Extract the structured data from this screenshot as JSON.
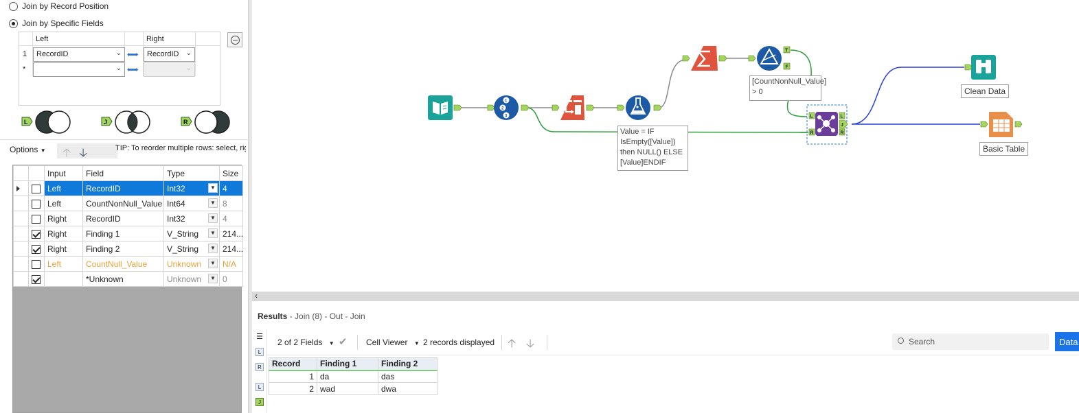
{
  "join_config": {
    "radio_position": "Join by Record Position",
    "radio_specific": "Join by Specific Fields",
    "col_left": "Left",
    "col_right": "Right",
    "rows": [
      {
        "num": "1",
        "left": "RecordID",
        "right": "RecordID"
      },
      {
        "num": "*",
        "left": "",
        "right": ""
      }
    ],
    "venn_labels": [
      "L",
      "J",
      "R"
    ]
  },
  "options_bar": {
    "options_label": "Options",
    "tip": "TIP: To reorder multiple rows: select, righ"
  },
  "field_grid": {
    "headers": [
      "Input",
      "Field",
      "Type",
      "Size"
    ],
    "rows": [
      {
        "checked": false,
        "input": "Left",
        "field": "RecordID",
        "type": "Int32",
        "size": "4"
      },
      {
        "checked": false,
        "input": "Left",
        "field": "CountNonNull_Value",
        "type": "Int64",
        "size": "8"
      },
      {
        "checked": false,
        "input": "Right",
        "field": "RecordID",
        "type": "Int32",
        "size": "4"
      },
      {
        "checked": true,
        "input": "Right",
        "field": "Finding 1",
        "type": "V_String",
        "size": "214..."
      },
      {
        "checked": true,
        "input": "Right",
        "field": "Finding 2",
        "type": "V_String",
        "size": "214..."
      },
      {
        "checked": false,
        "input": "Left",
        "field": "CountNull_Value",
        "type": "Unknown",
        "size": "N/A"
      },
      {
        "checked": true,
        "input": "",
        "field": "*Unknown",
        "type": "Unknown",
        "size": "0"
      }
    ]
  },
  "canvas": {
    "filter_annotation": "[CountNonNull_Value] > 0",
    "formula_annotation": "Value = IF IsEmpty([Value]) then NULL() ELSE [Value]ENDIF",
    "browse_label": "Clean Data",
    "table_label": "Basic Table",
    "anchors": {
      "true": "T",
      "false": "F",
      "left": "L",
      "join": "J",
      "right": "R"
    }
  },
  "results": {
    "title": "Results",
    "subtitle": " - Join (8) - Out - Join",
    "fields_label": "2 of 2 Fields",
    "viewer_label": "Cell Viewer",
    "records_label": "2 records displayed",
    "search_placeholder": "Search",
    "data_button": "Data",
    "side_icons": [
      "list-icon",
      "L",
      "R",
      "L",
      "J"
    ],
    "table": {
      "headers": [
        "Record",
        "Finding 1",
        "Finding 2"
      ],
      "rows": [
        {
          "record": "1",
          "finding1": "da",
          "finding2": "das"
        },
        {
          "record": "2",
          "finding1": "wad",
          "finding2": "dwa"
        }
      ]
    }
  },
  "colors": {
    "accent_blue": "#0f7ad9",
    "connection_gray": "#8a8a8a",
    "connection_green": "#2e9e3a",
    "connection_blue": "#2a3fd0",
    "warning_orange": "#e5a23a",
    "anchor_green": "#a4d65e"
  }
}
